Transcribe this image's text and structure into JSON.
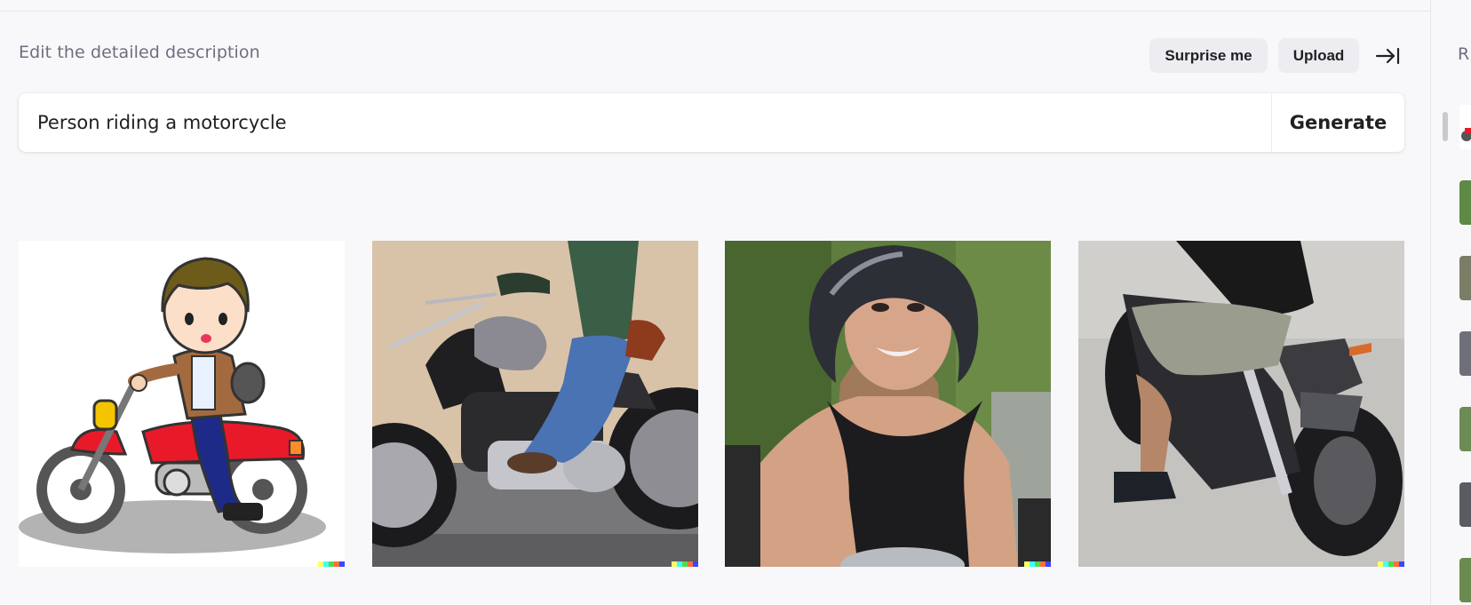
{
  "header": {
    "edit_label": "Edit the detailed description",
    "surprise_label": "Surprise me",
    "upload_label": "Upload",
    "collapse_icon": "arrow-right-to-line-icon"
  },
  "prompt": {
    "value": "Person riding a motorcycle",
    "generate_label": "Generate"
  },
  "results": {
    "images": [
      {
        "name": "cartoon-rider",
        "description_icon": "image"
      },
      {
        "name": "cruiser-rider",
        "description_icon": "image"
      },
      {
        "name": "helmet-woman",
        "description_icon": "image"
      },
      {
        "name": "rear-motorcycle",
        "description_icon": "image"
      }
    ],
    "signature_colors": [
      "#ffff66",
      "#42ffff",
      "#51da4c",
      "#ff6e3c",
      "#3c46ff"
    ]
  },
  "sidebar": {
    "heading": "R",
    "history_count": 7
  },
  "colors": {
    "background": "#f8f8fa",
    "pill": "#ececf1",
    "text": "#202123",
    "muted": "#6e6e80"
  }
}
